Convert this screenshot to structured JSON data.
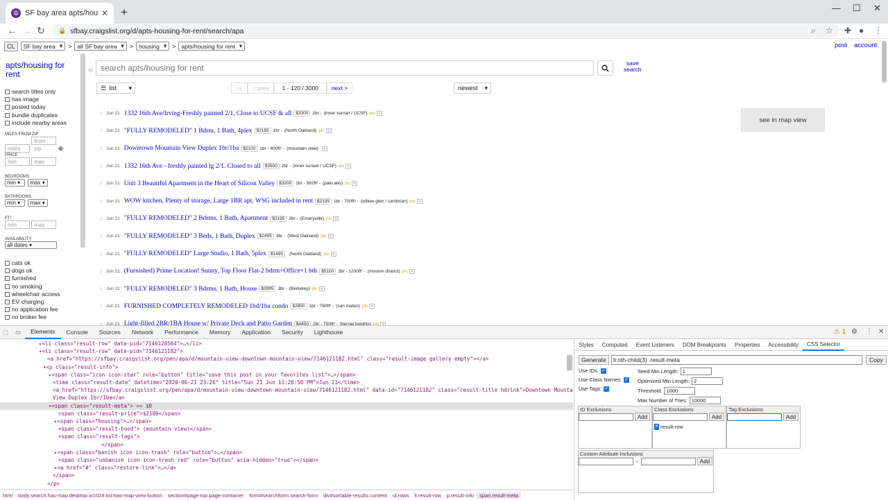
{
  "browser": {
    "tab_title": "SF bay area apts/housing for rent",
    "url": "sfbay.craigslist.org/d/apts-housing-for-rent/search/apa"
  },
  "cl": {
    "logo": "CL",
    "area_select": "SF bay area",
    "subarea_select": "all SF bay area",
    "category_select": "housing",
    "subcategory_select": "apts/housing for rent",
    "post_link": "post",
    "account_link": "account"
  },
  "sidebar": {
    "title": "apts/housing for rent",
    "filters": [
      "search titles only",
      "has image",
      "posted today",
      "bundle duplicates",
      "include nearby areas"
    ],
    "miles_label": "MILES FROM ZIP",
    "miles_placeholder": "miles",
    "zip_placeholder": "from zip",
    "price_label": "PRICE",
    "min_placeholder": "min",
    "max_placeholder": "max",
    "bedrooms_label": "BEDROOMS",
    "bathrooms_label": "BATHROOMS",
    "min_select": "min",
    "max_select": "max",
    "ft_label": "FT²",
    "availability_label": "AVAILABILITY",
    "availability_select": "all dates",
    "amenities": [
      "cats ok",
      "dogs ok",
      "furnished",
      "no smoking",
      "wheelchair access",
      "EV charging",
      "no application fee",
      "no broker fee"
    ]
  },
  "search": {
    "placeholder": "search apts/housing for rent",
    "save_line1": "save",
    "save_line2": "search",
    "view_select": "list",
    "pager_first": "<<",
    "pager_prev": "< prev",
    "pager_range": "1 - 120 / 3000",
    "pager_next": "next >",
    "sort_select": "newest",
    "map_view": "see in map view"
  },
  "results": [
    {
      "date": "Jun 21",
      "title": "1332 16th Ave/Irving-Freshly painted 2/1, Close to UCSF & all",
      "price": "$3300",
      "housing": "2br -",
      "hood": "(inner sunset / UCSF)",
      "pic": "pic"
    },
    {
      "date": "Jun 21",
      "title": "\"FULLY REMODELED\" 1 Bdrm, 1 Bath, 4plex",
      "price": "$2195",
      "housing": "1br -",
      "hood": "(North Oakland)",
      "pic": "pic"
    },
    {
      "date": "Jun 21",
      "title": "Downtown Mountain View Duplex 1br/1ba",
      "price": "$2100",
      "housing": "1br - 400ft² -",
      "hood": "(mountain view)",
      "pic": ""
    },
    {
      "date": "Jun 21",
      "title": "1332 16th Ave - freshly painted lg 2/1. Closed to all",
      "price": "$3500",
      "housing": "2br -",
      "hood": "(inner sunset / UCSF)",
      "pic": "pic"
    },
    {
      "date": "Jun 21",
      "title": "Unit 3 Beautiful Apartment in the Heart of Silicon Valley",
      "price": "$3200",
      "housing": "1br - 392ft² -",
      "hood": "(palo alto)",
      "pic": "pic"
    },
    {
      "date": "Jun 21",
      "title": "WOW kitchen, Plenty of storage, Large 1BR apt, WSG included in rent",
      "price": "$2195",
      "housing": "1br - 700ft² -",
      "hood": "(willow glen / cambrian)",
      "pic": "pic"
    },
    {
      "date": "Jun 21",
      "title": "\"FULLY REMODELED\" 2 Bdrms, 1 Bath, Apartment",
      "price": "$2195",
      "housing": "2br -",
      "hood": "(Emeryville)",
      "pic": "pic"
    },
    {
      "date": "Jun 21",
      "title": "\"FULLY REMODELED\" 3 Beds, 1 Bath, Duplex",
      "price": "$2495",
      "housing": "3br -",
      "hood": "(West Oakland)",
      "pic": "pic"
    },
    {
      "date": "Jun 21",
      "title": "\"FULLY REMODELED\" Large Studio, 1 Bath, 5plex",
      "price": "$1495",
      "housing": "",
      "hood": "(North Oakland)",
      "pic": "pic"
    },
    {
      "date": "Jun 21",
      "title": "(Furnished) Prime Location! Sunny, Top Floor Flat-2 bdrm+Office+1 bth",
      "price": "$5100",
      "housing": "2br - 1200ft² -",
      "hood": "(mission district)",
      "pic": "pic"
    },
    {
      "date": "Jun 21",
      "title": "\"FULLY REMODELED\" 3 Bdrms, 1 Bath, House",
      "price": "$3995",
      "housing": "3br -",
      "hood": "(Berkeley)",
      "pic": "pic"
    },
    {
      "date": "Jun 21",
      "title": "FURNISHED COMPLETELY REMODELED 1bd/1ba condo",
      "price": "$2850",
      "housing": "1br - 760ft² -",
      "hood": "(san mateo)",
      "pic": "pic"
    },
    {
      "date": "Jun 21",
      "title": "Light-filled 2BR/1BA House w/ Private Deck and Patio Garden",
      "price": "$4450",
      "housing": "2br - 750ft² -",
      "hood": "(bernal heights)",
      "pic": "pic"
    }
  ],
  "devtools": {
    "tabs": [
      "Elements",
      "Console",
      "Sources",
      "Network",
      "Performance",
      "Memory",
      "Application",
      "Security",
      "Lighthouse"
    ],
    "warn_count": "1",
    "elements": [
      {
        "indent": 56,
        "text": "▸<li class=\"result-row\" data-pid=\"7146120564\">…</li>",
        "hl": false
      },
      {
        "indent": 56,
        "text": "▾<li class=\"result-row\" data-pid=\"7146121182\">",
        "hl": false
      },
      {
        "indent": 68,
        "text": "<a href=\"https://sfbay.craigslist.org/pen/apa/d/mountain-view-downtown-mountain-view/7146121182.html\" class=\"result-image gallery empty\"></a>",
        "hl": false
      },
      {
        "indent": 62,
        "text": "▾<p class=\"result-info\">",
        "hl": false
      },
      {
        "indent": 70,
        "text": "▸<span class=\"icon icon-star\" role=\"button\" title=\"save this post in your favorites list\">…</span>",
        "hl": false
      },
      {
        "indent": 76,
        "text": "<time class=\"result-date\" datetime=\"2020-06-21 23:26\" title=\"Sun 21 Jun 11:26:50 PM\">Jun 21</time>",
        "hl": false
      },
      {
        "indent": 76,
        "text": "<a href=\"https://sfbay.craigslist.org/pen/apa/d/mountain-view-downtown-mountain-view/7146121182.html\" data-id=\"7146121182\" class=\"result-title hdrlnk\">Downtown Mountain",
        "hl": false
      },
      {
        "indent": 76,
        "text": "View Duplex 1br/1ba</a>",
        "hl": false
      },
      {
        "indent": 70,
        "text": "▾<span class=\"result-meta\"> == $0",
        "hl": true
      },
      {
        "indent": 84,
        "text": "<span class=\"result-price\">$2100</span>",
        "hl": false
      },
      {
        "indent": 78,
        "text": "▸<span class=\"housing\">…</span>",
        "hl": false
      },
      {
        "indent": 84,
        "text": "<span class=\"result-hood\"> (mountain view)</span>",
        "hl": false
      },
      {
        "indent": 84,
        "text": "<span class=\"result-tags\">",
        "hl": false
      },
      {
        "indent": 146,
        "text": "</span>",
        "hl": false
      },
      {
        "indent": 78,
        "text": "▸<span class=\"banish icon icon-trash\" role=\"button\">…</span>",
        "hl": false
      },
      {
        "indent": 84,
        "text": "<span class=\"unbanish icon icon-trash red\" role=\"button\" aria-hidden=\"true\"></span>",
        "hl": false
      },
      {
        "indent": 78,
        "text": "▸<a href=\"#\" class=\"restore-link\">…</a>",
        "hl": false
      },
      {
        "indent": 76,
        "text": "</span>",
        "hl": false
      },
      {
        "indent": 68,
        "text": "</p>",
        "hl": false
      }
    ],
    "breadcrumbs": [
      "html",
      "body.search.has-map.desktop.w1024.list.has-map-view-button",
      "section#page-top.page-container",
      "form#searchform.search-form",
      "div#sortable-results.content",
      "ul.rows",
      "li.result-row",
      "p.result-info",
      "span.result-meta"
    ],
    "panel_tabs": [
      "Styles",
      "Computed",
      "Event Listeners",
      "DOM Breakpoints",
      "Properties",
      "Accessibility",
      "CSS Selector"
    ],
    "css_selector": {
      "generate": "Generate",
      "selector_value": "li:nth-child(3) .result-meta",
      "copy": "Copy",
      "use_ids": "Use IDs:",
      "use_class_names": "Use Class Names:",
      "use_tags": "Use Tags:",
      "seed_min_length_label": "Seed Min Length:",
      "seed_min_length": "1",
      "optimized_min_length_label": "Optimized Min Length:",
      "optimized_min_length": "2",
      "threshold_label": "Threshold:",
      "threshold": "1000",
      "max_tries_label": "Max Number of Tries:",
      "max_tries": "10000",
      "id_exclusions": "ID Exclusions",
      "class_exclusions": "Class Exclusions",
      "tag_exclusions": "Tag Exclusions",
      "add": "Add",
      "class_chip": "result-row",
      "custom_attr": "Custom Attribute Inclusions",
      "equals": "="
    }
  }
}
